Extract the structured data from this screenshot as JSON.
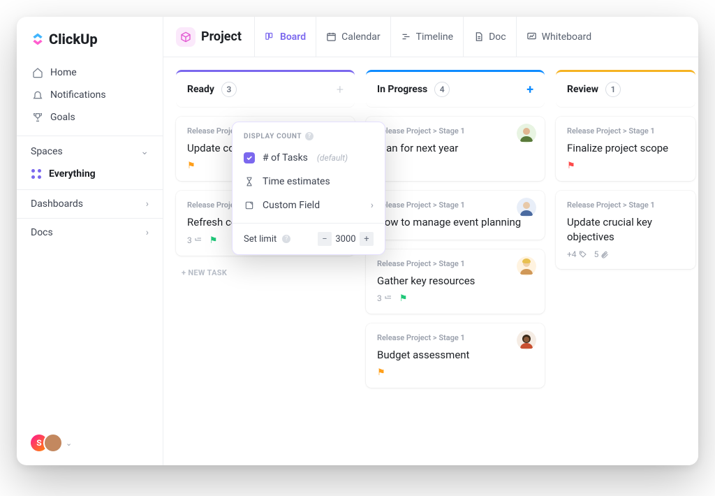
{
  "brand": "ClickUp",
  "nav": {
    "home": "Home",
    "notifications": "Notifications",
    "goals": "Goals"
  },
  "sections": {
    "spaces": "Spaces",
    "everything": "Everything",
    "dashboards": "Dashboards",
    "docs": "Docs"
  },
  "avatar_initial": "S",
  "topbar": {
    "project": "Project",
    "views": {
      "board": "Board",
      "calendar": "Calendar",
      "timeline": "Timeline",
      "doc": "Doc",
      "whiteboard": "Whiteboard"
    }
  },
  "columns": {
    "ready": {
      "title": "Ready",
      "count": "3"
    },
    "progress": {
      "title": "In Progress",
      "count": "4"
    },
    "review": {
      "title": "Review",
      "count": "1"
    }
  },
  "breadcrumb_prefix": "Release Project > Stage 1",
  "cards": {
    "ready1": {
      "title": "Update contractor agreement"
    },
    "ready2": {
      "title": "Refresh company website",
      "subtasks": "3"
    },
    "progress1": {
      "title": "Plan for next year"
    },
    "progress2": {
      "title": "How to manage event planning"
    },
    "progress3": {
      "title": "Gather key resources",
      "subtasks": "3"
    },
    "progress4": {
      "title": "Budget assessment"
    },
    "review1": {
      "title": "Finalize project scope"
    },
    "review2": {
      "title": "Update crucial key objectives",
      "plus": "+4",
      "attach": "5"
    }
  },
  "new_task": "+ NEW TASK",
  "popover": {
    "header": "DISPLAY COUNT",
    "opt_tasks": "# of Tasks",
    "opt_tasks_suffix": "(default)",
    "opt_time": "Time estimates",
    "opt_custom": "Custom Field",
    "limit_label": "Set limit",
    "limit_value": "3000"
  }
}
